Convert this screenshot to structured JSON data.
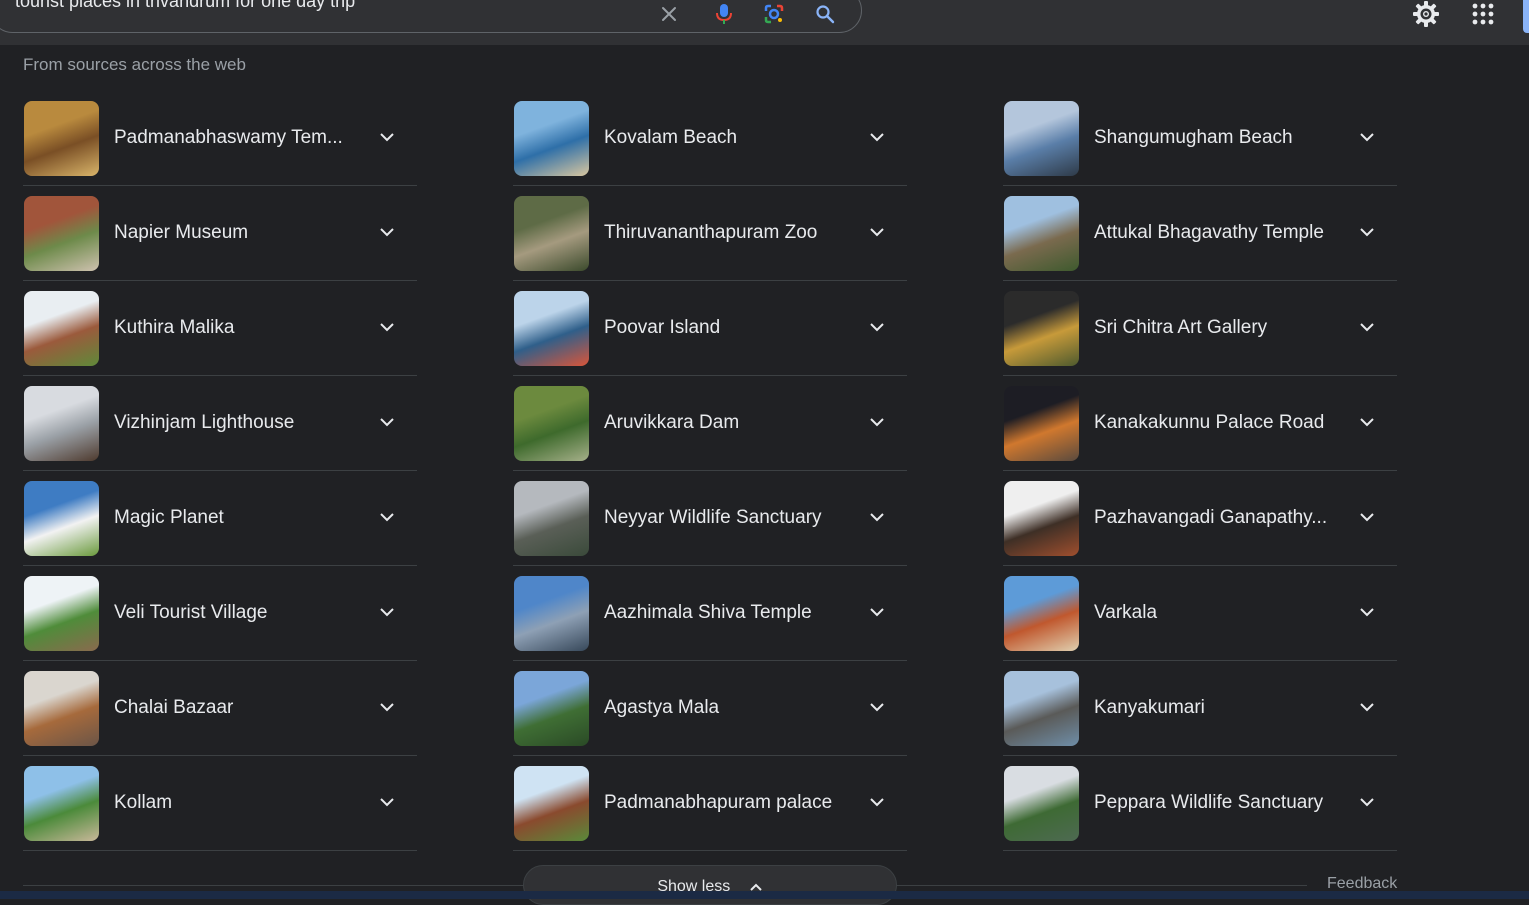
{
  "search": {
    "query": "tourist places in trivandrum for one day trip"
  },
  "subheading": "From sources across the web",
  "columns": [
    [
      {
        "label": "Padmanabhaswamy Tem...",
        "thumb": [
          "#b98a3e",
          "#7a4f25",
          "#d9b56a"
        ]
      },
      {
        "label": "Napier Museum",
        "thumb": [
          "#a1553b",
          "#6d8a4a",
          "#cfc2b0"
        ]
      },
      {
        "label": "Kuthira Malika",
        "thumb": [
          "#e9eef2",
          "#9b5a3c",
          "#5f8a3a"
        ]
      },
      {
        "label": "Vizhinjam Lighthouse",
        "thumb": [
          "#d8dbe0",
          "#9aa0a6",
          "#4e3a2e"
        ]
      },
      {
        "label": "Magic Planet",
        "thumb": [
          "#3e7cc3",
          "#f2f2f2",
          "#6a9a3c"
        ]
      },
      {
        "label": "Veli Tourist Village",
        "thumb": [
          "#eef3f6",
          "#4f8c3a",
          "#8a6a4e"
        ]
      },
      {
        "label": "Chalai Bazaar",
        "thumb": [
          "#dad6cf",
          "#a66a3c",
          "#6b5547"
        ]
      },
      {
        "label": "Kollam",
        "thumb": [
          "#8ec0e8",
          "#4b8a3a",
          "#c9b89a"
        ]
      }
    ],
    [
      {
        "label": "Kovalam Beach",
        "thumb": [
          "#7fb3dd",
          "#2e6fa8",
          "#d9c7a0"
        ]
      },
      {
        "label": "Thiruvananthapuram Zoo",
        "thumb": [
          "#5e6b46",
          "#a59a7f",
          "#3b4a2c"
        ]
      },
      {
        "label": "Poovar Island",
        "thumb": [
          "#bcd4ea",
          "#2f5f8a",
          "#d9563a"
        ]
      },
      {
        "label": "Aruvikkara Dam",
        "thumb": [
          "#6c8a3e",
          "#3e6a2c",
          "#a6b08a"
        ]
      },
      {
        "label": "Neyyar Wildlife Sanctuary",
        "thumb": [
          "#b5b9be",
          "#5a5f57",
          "#3a4a3a"
        ]
      },
      {
        "label": "Aazhimala Shiva Temple",
        "thumb": [
          "#4f86c9",
          "#8ea0b5",
          "#37485a"
        ]
      },
      {
        "label": "Agastya Mala",
        "thumb": [
          "#7ba6d9",
          "#3f6e34",
          "#2a4a26"
        ]
      },
      {
        "label": "Padmanabhapuram palace",
        "thumb": [
          "#cfe3f3",
          "#8a4a2e",
          "#5a8a3a"
        ]
      }
    ],
    [
      {
        "label": "Shangumugham Beach",
        "thumb": [
          "#b4c6dc",
          "#5a7ea8",
          "#2e3a48"
        ]
      },
      {
        "label": "Attukal Bhagavathy Temple",
        "thumb": [
          "#9fc0e0",
          "#7a6a4e",
          "#3e5a2e"
        ]
      },
      {
        "label": "Sri Chitra Art Gallery",
        "thumb": [
          "#2b2b2b",
          "#c79a3a",
          "#4e5a2e"
        ]
      },
      {
        "label": "Kanakakunnu Palace Road",
        "thumb": [
          "#1d1d24",
          "#d0782e",
          "#5a4a3e"
        ]
      },
      {
        "label": "Pazhavangadi Ganapathy...",
        "thumb": [
          "#efefef",
          "#3e2f26",
          "#a04f2e"
        ]
      },
      {
        "label": "Varkala",
        "thumb": [
          "#5d9bd8",
          "#c0582e",
          "#e0d0b0"
        ]
      },
      {
        "label": "Kanyakumari",
        "thumb": [
          "#a7c1dc",
          "#5a5a58",
          "#6f8ea8"
        ]
      },
      {
        "label": "Peppara Wildlife Sanctuary",
        "thumb": [
          "#d9dde2",
          "#3e6a34",
          "#4e6a52"
        ]
      }
    ]
  ],
  "show_less": "Show less",
  "feedback": "Feedback"
}
